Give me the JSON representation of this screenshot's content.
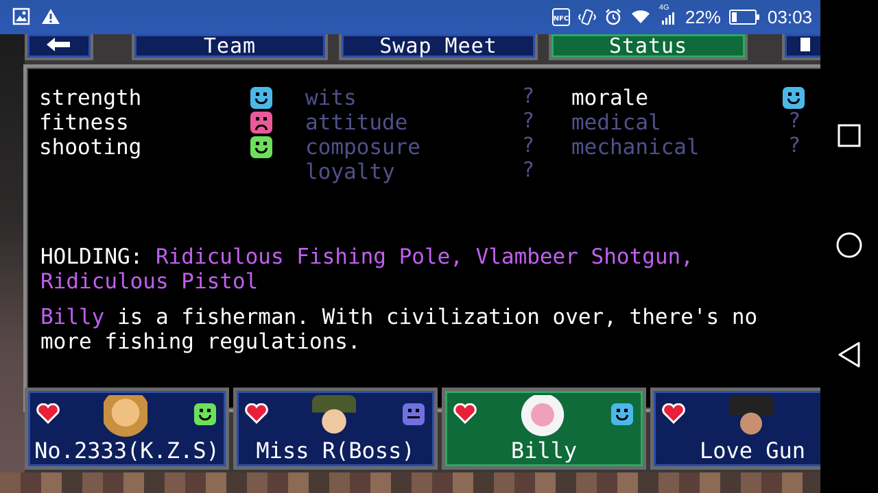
{
  "status_bar": {
    "battery_percent": "22%",
    "battery_level": 0.22,
    "time": "03:03",
    "network": "4G",
    "nfc": "NFC",
    "icons_left": [
      "gallery-icon",
      "warning-icon"
    ],
    "icons_right": [
      "nfc-icon",
      "vibrate-icon",
      "alarm-icon",
      "wifi-icon",
      "signal-icon",
      "battery-icon"
    ]
  },
  "tabs": [
    {
      "label": "",
      "icon": "back-arrow-icon"
    },
    {
      "label": "Team"
    },
    {
      "label": "Swap Meet"
    },
    {
      "label": "Status",
      "active": true
    },
    {
      "label": "",
      "icon": "next-icon"
    }
  ],
  "stats": {
    "col1": [
      {
        "label": "strength",
        "mood": "happy",
        "color": "#4cb8e8"
      },
      {
        "label": "fitness",
        "mood": "sad",
        "color": "#e85a9a"
      },
      {
        "label": "shooting",
        "mood": "happy",
        "color": "#6ce05a"
      }
    ],
    "col2": [
      {
        "label": "wits",
        "value": "?"
      },
      {
        "label": "attitude",
        "value": "?"
      },
      {
        "label": "composure",
        "value": "?"
      },
      {
        "label": "loyalty",
        "value": "?"
      }
    ],
    "col3": [
      {
        "label": "morale",
        "mood": "happy",
        "color": "#4cb8e8"
      },
      {
        "label": "medical",
        "value": "?"
      },
      {
        "label": "mechanical",
        "value": "?"
      }
    ]
  },
  "holding": {
    "label": "HOLDING:",
    "items": "Ridiculous Fishing Pole, Vlambeer Shotgun, Ridiculous Pistol"
  },
  "description": {
    "name": "Billy",
    "text": " is a fisherman. With civilization over, there's no more fishing regulations."
  },
  "characters": [
    {
      "name": "No.2333(K.Z.S)",
      "mood_color": "#6ce05a",
      "active": false
    },
    {
      "name": "Miss R(Boss)",
      "mood_color": "#7070e0",
      "active": false
    },
    {
      "name": "Billy",
      "mood_color": "#4cb8e8",
      "active": true
    },
    {
      "name": "Love Gun",
      "mood_color": "#6ce05a",
      "active": false
    }
  ],
  "colors": {
    "tab_blue": "#0d1f5c",
    "tab_green": "#0f6b3a",
    "highlight_purple": "#c060f0",
    "unknown_stat": "#50508a"
  }
}
